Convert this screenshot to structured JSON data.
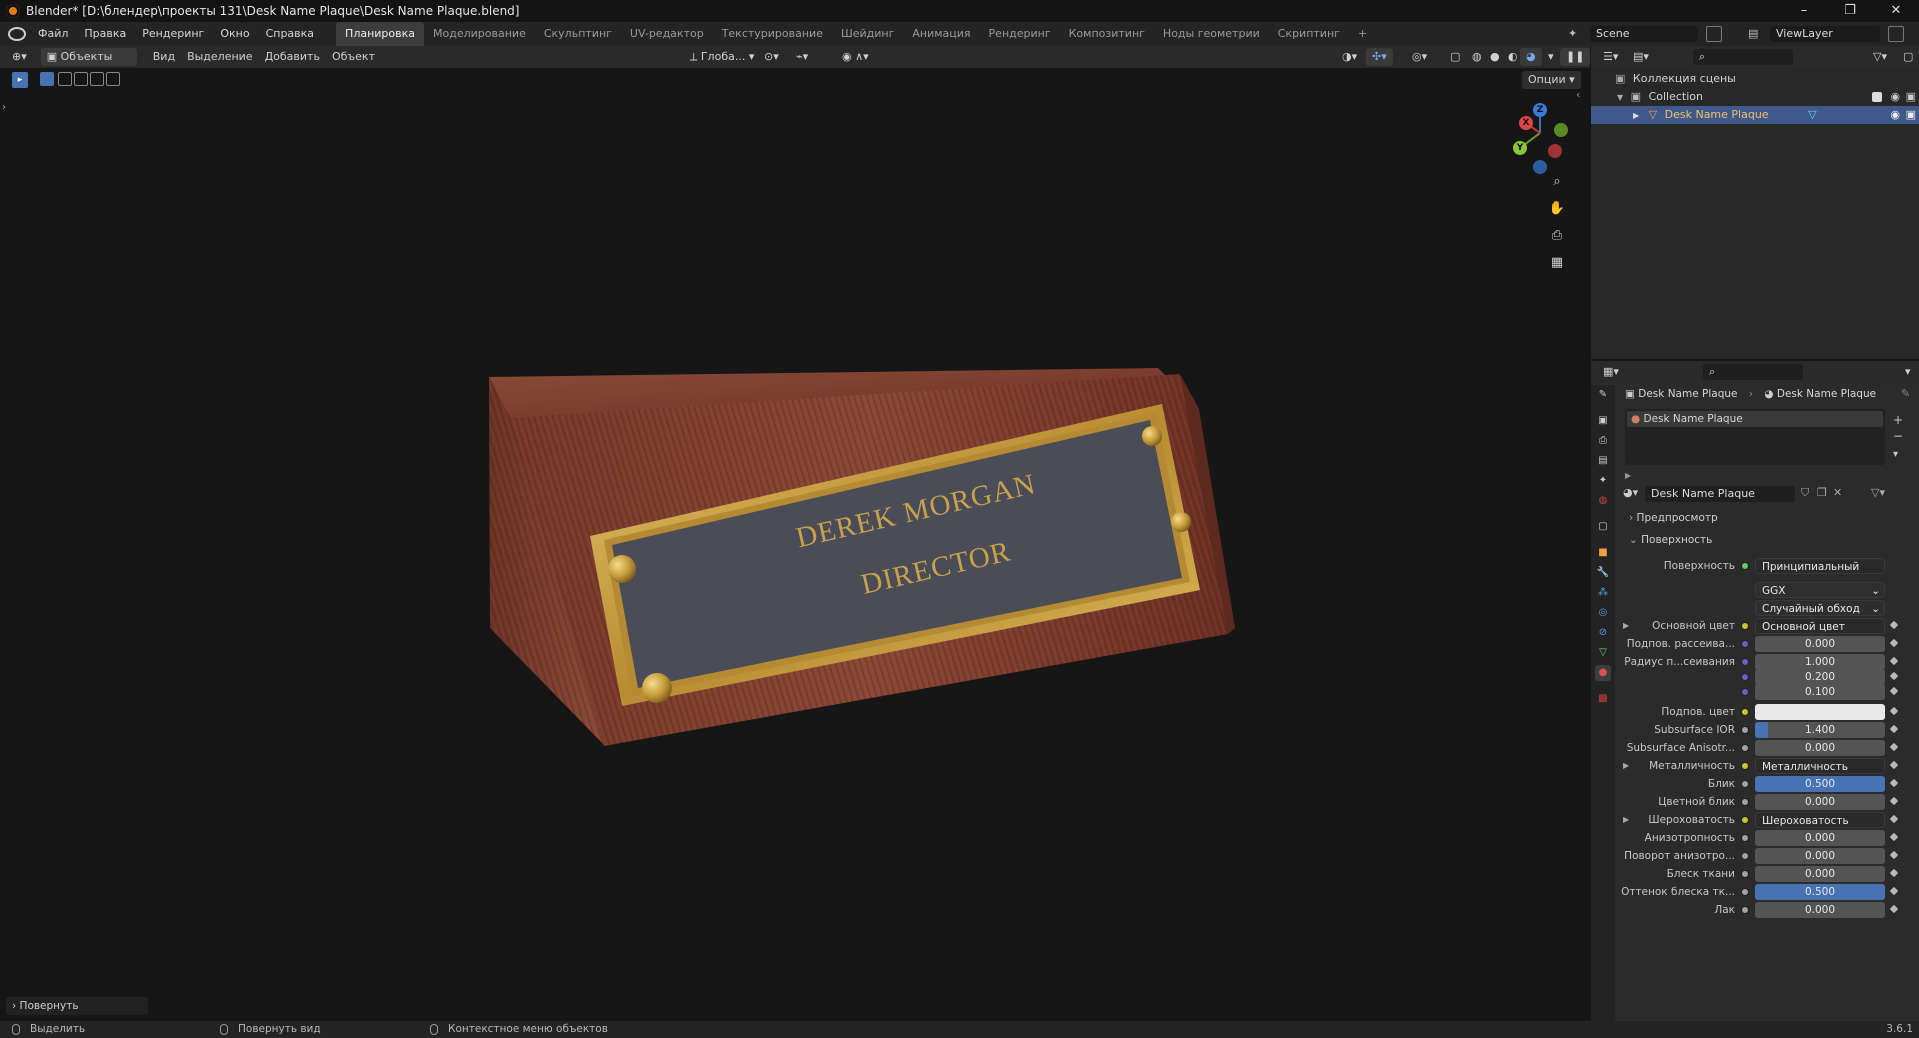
{
  "window": {
    "title": "Blender* [D:\\блендер\\проекты 131\\Desk Name Plaque\\Desk Name Plaque.blend]",
    "minimize": "–",
    "maximize": "❐",
    "close": "✕"
  },
  "menu": [
    "Файл",
    "Правка",
    "Рендеринг",
    "Окно",
    "Справка"
  ],
  "workspaces": [
    "Планировка",
    "Моделирование",
    "Скульптинг",
    "UV-редактор",
    "Текстурирование",
    "Шейдинг",
    "Анимация",
    "Рендеринг",
    "Композитинг",
    "Ноды геометрии",
    "Скриптинг"
  ],
  "workspace_add": "+",
  "scene": {
    "name": "Scene",
    "view_layer": "ViewLayer"
  },
  "viewport_header": {
    "mode": "Объекты",
    "menus": [
      "Вид",
      "Выделение",
      "Добавить",
      "Объект"
    ],
    "transform_orientation": "Глоба...",
    "options": "Опции"
  },
  "viewport": {
    "plaque_line1": "DEREK MORGAN",
    "plaque_line2": "DIRECTOR",
    "last_operator": "Повернуть",
    "gizmo": {
      "x": "X",
      "y": "Y",
      "z": "Z"
    }
  },
  "outliner": {
    "root": "Коллекция сцены",
    "collection": "Collection",
    "object": "Desk Name Plaque"
  },
  "properties": {
    "breadcrumb_object": "Desk Name Plaque",
    "breadcrumb_material": "Desk Name Plaque",
    "slot_name": "Desk Name Plaque",
    "material_name": "Desk Name Plaque",
    "panel_preview": "Предпросмотр",
    "panel_surface": "Поверхность",
    "surface_label": "Поверхность",
    "surface_value": "Принципиальный BSDF",
    "distribution": "GGX",
    "subsurface_method": "Случайный обход",
    "rows": [
      {
        "label": "Основной цвет",
        "value": "Основной цвет",
        "kind": "node",
        "expand": true
      },
      {
        "label": "Подпов. рассеива...",
        "value": "0.000",
        "fill": 0
      },
      {
        "label": "Радиус п...сеивания",
        "value": "1.000",
        "fill": 0
      },
      {
        "label": "",
        "value": "0.200",
        "fill": 0
      },
      {
        "label": "",
        "value": "0.100",
        "fill": 0
      },
      {
        "label": "Подпов. цвет",
        "value": "",
        "kind": "color",
        "color": "#e8e8e8"
      },
      {
        "label": "Subsurface IOR",
        "value": "1.400",
        "fill": 0.1
      },
      {
        "label": "Subsurface Anisotr...",
        "value": "0.000",
        "fill": 0
      },
      {
        "label": "Металличность",
        "value": "Металличность",
        "kind": "node",
        "expand": true
      },
      {
        "label": "Блик",
        "value": "0.500",
        "fill": 1
      },
      {
        "label": "Цветной блик",
        "value": "0.000",
        "fill": 0
      },
      {
        "label": "Шероховатость",
        "value": "Шероховатость",
        "kind": "node",
        "expand": true
      },
      {
        "label": "Анизотропность",
        "value": "0.000",
        "fill": 0
      },
      {
        "label": "Поворот анизотро...",
        "value": "0.000",
        "fill": 0
      },
      {
        "label": "Блеск ткани",
        "value": "0.000",
        "fill": 0
      },
      {
        "label": "Оттенок блеска тк...",
        "value": "0.500",
        "fill": 1
      },
      {
        "label": "Лак",
        "value": "0.000",
        "fill": 0
      }
    ]
  },
  "statusbar": {
    "select": "Выделить",
    "rotate": "Повернуть вид",
    "context": "Контекстное меню объектов",
    "version": "3.6.1"
  },
  "colors": {
    "accent": "#4772b3",
    "selection": "#3f5a8a",
    "wood": "#7a3b2c",
    "brass": "#c9a24a"
  }
}
